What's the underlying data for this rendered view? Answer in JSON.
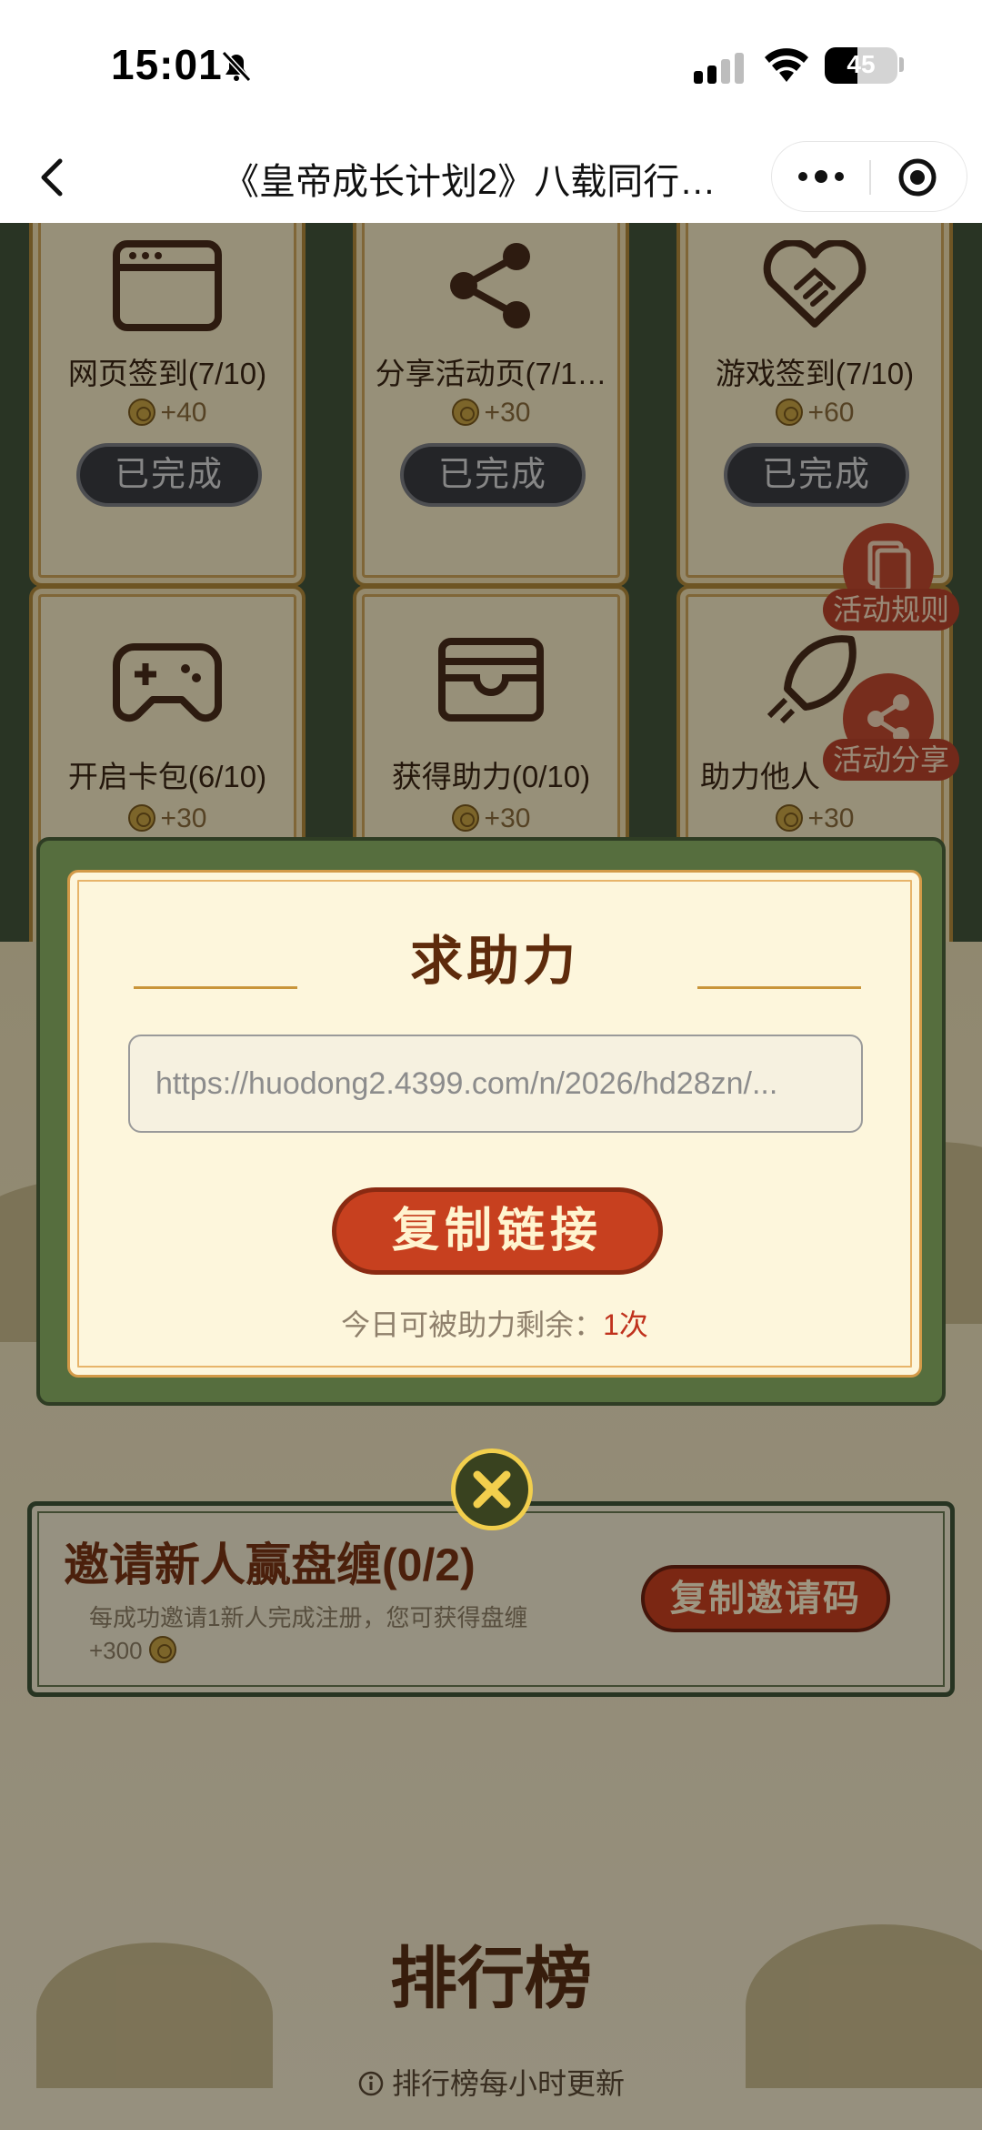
{
  "status_bar": {
    "time": "15:01",
    "battery": "45",
    "battery_level": 0.45
  },
  "nav": {
    "title": "《皇帝成长计划2》八载同行…"
  },
  "tasks": [
    {
      "label": "网页签到(7/10)",
      "reward": "+40",
      "status": "已完成",
      "icon": "browser-icon"
    },
    {
      "label": "分享活动页(7/1…",
      "reward": "+30",
      "status": "已完成",
      "icon": "share-icon"
    },
    {
      "label": "游戏签到(7/10)",
      "reward": "+60",
      "status": "已完成",
      "icon": "handshake-heart-icon"
    },
    {
      "label": "开启卡包(6/10)",
      "reward": "+30",
      "icon": "gamepad-icon"
    },
    {
      "label": "获得助力(0/10)",
      "reward": "+30",
      "icon": "wallet-icon"
    },
    {
      "label": "助力他人",
      "reward": "+30",
      "icon": "rocket-icon"
    }
  ],
  "float_buttons": {
    "rules": "活动规则",
    "share": "活动分享"
  },
  "modal": {
    "title": "求助力",
    "link": "https://huodong2.4399.com/n/2026/hd28zn/...",
    "copy_button": "复制链接",
    "remain_label": "今日可被助力剩余：",
    "remain_count": "1次"
  },
  "invite": {
    "title": "邀请新人赢盘缠(0/2)",
    "desc": "每成功邀请1新人完成注册，您可获得盘缠",
    "reward": "+300",
    "button": "复制邀请码"
  },
  "ranking": {
    "title": "排行榜",
    "note": "排行榜每小时更新"
  },
  "colors": {
    "accent_red": "#c7401f",
    "dark_green": "#43553a",
    "gold": "#b28a3a"
  }
}
